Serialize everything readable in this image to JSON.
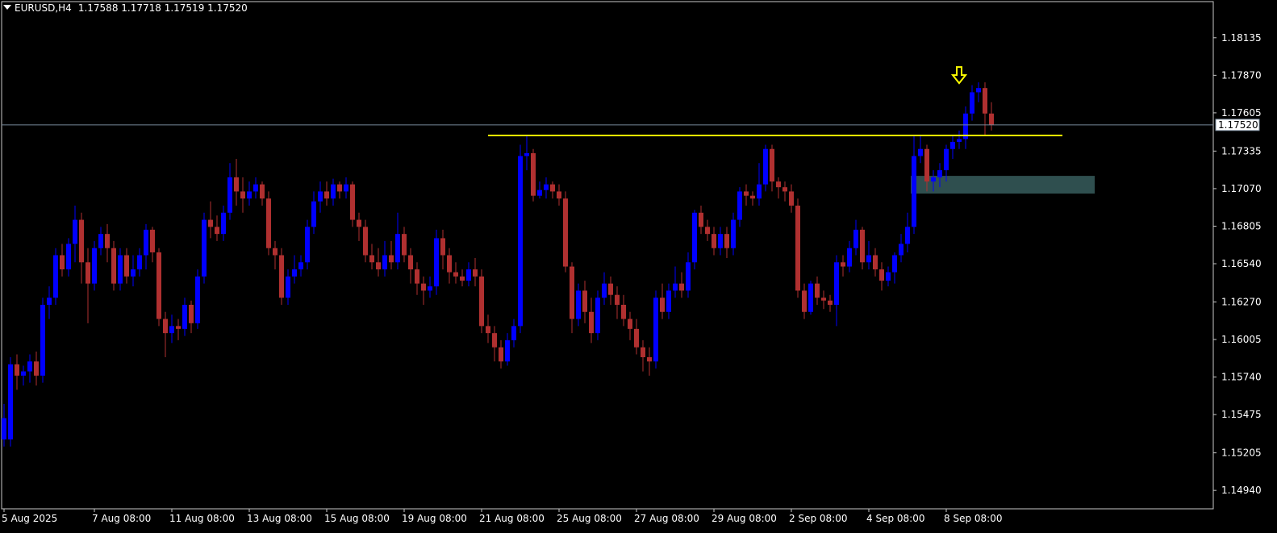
{
  "header": {
    "symbol_timeframe": "EURUSD,H4",
    "ohlc": "1.17588 1.17718 1.17519 1.17520"
  },
  "colors": {
    "background": "#000000",
    "frame": "#c8c8c8",
    "bull": "#0000ff",
    "bear": "#b03030",
    "resistance_line": "#ffff00",
    "zone_fill": "#2f4f4f",
    "bid_line": "#778899",
    "arrow": "#ffff00",
    "text": "#ffffff"
  },
  "chart_data": {
    "type": "candlestick",
    "symbol": "EURUSD",
    "timeframe": "H4",
    "ylim": [
      1.1481,
      1.1839
    ],
    "y_ticks": [
      "1.18135",
      "1.17870",
      "1.17605",
      "1.17335",
      "1.17070",
      "1.16805",
      "1.16540",
      "1.16270",
      "1.16005",
      "1.15740",
      "1.15475",
      "1.15205",
      "1.14940"
    ],
    "x_ticks": [
      "5 Aug 2025",
      "7 Aug 08:00",
      "11 Aug 08:00",
      "13 Aug 08:00",
      "15 Aug 08:00",
      "19 Aug 08:00",
      "21 Aug 08:00",
      "25 Aug 08:00",
      "27 Aug 08:00",
      "29 Aug 08:00",
      "2 Sep 08:00",
      "4 Sep 08:00",
      "8 Sep 08:00"
    ],
    "x_tick_candle_index": [
      0,
      14,
      26,
      38,
      50,
      62,
      74,
      86,
      98,
      110,
      122,
      134,
      146
    ],
    "current_price": "1.17520",
    "resistance_level": 1.17445,
    "resistance_from_index": 75,
    "resistance_to_index": 164,
    "demand_zone": {
      "low": 1.17035,
      "high": 1.1716,
      "from_index": 141,
      "to_index": 169
    },
    "signal_arrow": {
      "index": 148,
      "direction": "down",
      "price": 1.1786
    },
    "candles": [
      [
        1.153,
        1.1545,
        1.1525,
        1.1555
      ],
      [
        1.153,
        1.1583,
        1.1525,
        1.1588
      ],
      [
        1.1583,
        1.1575,
        1.1565,
        1.159
      ],
      [
        1.1575,
        1.1578,
        1.1568,
        1.1582
      ],
      [
        1.1578,
        1.1585,
        1.157,
        1.159
      ],
      [
        1.1585,
        1.1575,
        1.1568,
        1.1592
      ],
      [
        1.1575,
        1.1625,
        1.157,
        1.163
      ],
      [
        1.1625,
        1.163,
        1.1615,
        1.1638
      ],
      [
        1.163,
        1.166,
        1.1625,
        1.1665
      ],
      [
        1.166,
        1.165,
        1.1645,
        1.1668
      ],
      [
        1.165,
        1.1668,
        1.1645,
        1.1672
      ],
      [
        1.1668,
        1.1685,
        1.1655,
        1.1695
      ],
      [
        1.1685,
        1.1655,
        1.164,
        1.169
      ],
      [
        1.1655,
        1.164,
        1.1612,
        1.1665
      ],
      [
        1.164,
        1.1665,
        1.1635,
        1.167
      ],
      [
        1.1665,
        1.1675,
        1.166,
        1.168
      ],
      [
        1.1675,
        1.1665,
        1.1655,
        1.1682
      ],
      [
        1.1665,
        1.164,
        1.1635,
        1.167
      ],
      [
        1.164,
        1.166,
        1.1635,
        1.1665
      ],
      [
        1.166,
        1.1645,
        1.164,
        1.1665
      ],
      [
        1.1645,
        1.165,
        1.1638,
        1.166
      ],
      [
        1.165,
        1.166,
        1.1645,
        1.1665
      ],
      [
        1.166,
        1.1678,
        1.165,
        1.1682
      ],
      [
        1.1678,
        1.1662,
        1.1655,
        1.168
      ],
      [
        1.1662,
        1.1615,
        1.161,
        1.1665
      ],
      [
        1.1615,
        1.1605,
        1.1588,
        1.162
      ],
      [
        1.1605,
        1.161,
        1.1598,
        1.1618
      ],
      [
        1.161,
        1.1608,
        1.16,
        1.1615
      ],
      [
        1.1608,
        1.1625,
        1.1603,
        1.163
      ],
      [
        1.1625,
        1.1612,
        1.1605,
        1.1628
      ],
      [
        1.1612,
        1.1645,
        1.1608,
        1.165
      ],
      [
        1.1645,
        1.1685,
        1.164,
        1.169
      ],
      [
        1.1685,
        1.168,
        1.1672,
        1.1698
      ],
      [
        1.168,
        1.1675,
        1.167,
        1.1688
      ],
      [
        1.1675,
        1.169,
        1.167,
        1.1695
      ],
      [
        1.169,
        1.1715,
        1.1685,
        1.1725
      ],
      [
        1.1715,
        1.1705,
        1.1695,
        1.1728
      ],
      [
        1.1705,
        1.17,
        1.169,
        1.1715
      ],
      [
        1.17,
        1.1705,
        1.1695,
        1.1712
      ],
      [
        1.1705,
        1.171,
        1.17,
        1.1715
      ],
      [
        1.171,
        1.17,
        1.1695,
        1.1712
      ],
      [
        1.17,
        1.1665,
        1.166,
        1.1705
      ],
      [
        1.1665,
        1.166,
        1.165,
        1.167
      ],
      [
        1.166,
        1.163,
        1.1625,
        1.1665
      ],
      [
        1.163,
        1.1645,
        1.1625,
        1.165
      ],
      [
        1.1645,
        1.165,
        1.164,
        1.166
      ],
      [
        1.165,
        1.1655,
        1.1645,
        1.166
      ],
      [
        1.1655,
        1.168,
        1.165,
        1.1685
      ],
      [
        1.168,
        1.1698,
        1.1675,
        1.1705
      ],
      [
        1.1698,
        1.1705,
        1.169,
        1.1712
      ],
      [
        1.1705,
        1.17,
        1.1695,
        1.1712
      ],
      [
        1.17,
        1.171,
        1.1695,
        1.1714
      ],
      [
        1.171,
        1.1705,
        1.17,
        1.1712
      ],
      [
        1.1705,
        1.171,
        1.17,
        1.1715
      ],
      [
        1.171,
        1.1685,
        1.168,
        1.1712
      ],
      [
        1.1685,
        1.168,
        1.167,
        1.169
      ],
      [
        1.168,
        1.166,
        1.1655,
        1.1685
      ],
      [
        1.166,
        1.1655,
        1.165,
        1.1668
      ],
      [
        1.1655,
        1.165,
        1.1645,
        1.1665
      ],
      [
        1.165,
        1.166,
        1.1645,
        1.167
      ],
      [
        1.166,
        1.1655,
        1.165,
        1.167
      ],
      [
        1.1655,
        1.1675,
        1.165,
        1.169
      ],
      [
        1.1675,
        1.166,
        1.1655,
        1.168
      ],
      [
        1.166,
        1.165,
        1.164,
        1.1665
      ],
      [
        1.165,
        1.164,
        1.1632,
        1.1655
      ],
      [
        1.164,
        1.1635,
        1.1625,
        1.1645
      ],
      [
        1.1635,
        1.1638,
        1.163,
        1.1645
      ],
      [
        1.1638,
        1.1672,
        1.1632,
        1.1678
      ],
      [
        1.1672,
        1.166,
        1.165,
        1.1678
      ],
      [
        1.166,
        1.1648,
        1.164,
        1.1665
      ],
      [
        1.1648,
        1.1645,
        1.164,
        1.1655
      ],
      [
        1.1645,
        1.1642,
        1.1638,
        1.165
      ],
      [
        1.1642,
        1.165,
        1.1638,
        1.1655
      ],
      [
        1.165,
        1.1645,
        1.1638,
        1.1658
      ],
      [
        1.1645,
        1.161,
        1.1605,
        1.165
      ],
      [
        1.161,
        1.1605,
        1.1598,
        1.1618
      ],
      [
        1.1605,
        1.1595,
        1.1585,
        1.161
      ],
      [
        1.1595,
        1.1585,
        1.158,
        1.16
      ],
      [
        1.1585,
        1.16,
        1.1582,
        1.1605
      ],
      [
        1.16,
        1.161,
        1.1595,
        1.1615
      ],
      [
        1.161,
        1.173,
        1.1605,
        1.1738
      ],
      [
        1.173,
        1.1732,
        1.172,
        1.1745
      ],
      [
        1.1732,
        1.1702,
        1.1698,
        1.1735
      ],
      [
        1.1702,
        1.1706,
        1.17,
        1.1712
      ],
      [
        1.1706,
        1.171,
        1.17,
        1.1715
      ],
      [
        1.171,
        1.1705,
        1.17,
        1.1712
      ],
      [
        1.1705,
        1.17,
        1.1695,
        1.171
      ],
      [
        1.17,
        1.1652,
        1.1648,
        1.1705
      ],
      [
        1.1652,
        1.1615,
        1.1605,
        1.1655
      ],
      [
        1.1615,
        1.1635,
        1.161,
        1.164
      ],
      [
        1.1635,
        1.162,
        1.1612,
        1.1642
      ],
      [
        1.162,
        1.1605,
        1.1598,
        1.163
      ],
      [
        1.1605,
        1.163,
        1.16,
        1.1635
      ],
      [
        1.163,
        1.164,
        1.1625,
        1.1648
      ],
      [
        1.164,
        1.1632,
        1.1625,
        1.1645
      ],
      [
        1.1632,
        1.1625,
        1.1615,
        1.1638
      ],
      [
        1.1625,
        1.1615,
        1.161,
        1.1632
      ],
      [
        1.1615,
        1.1608,
        1.16,
        1.162
      ],
      [
        1.1608,
        1.1595,
        1.159,
        1.1615
      ],
      [
        1.1595,
        1.1588,
        1.1578,
        1.16
      ],
      [
        1.1588,
        1.1585,
        1.1575,
        1.1595
      ],
      [
        1.1585,
        1.163,
        1.158,
        1.1635
      ],
      [
        1.163,
        1.162,
        1.1615,
        1.164
      ],
      [
        1.162,
        1.1635,
        1.1615,
        1.164
      ],
      [
        1.1635,
        1.164,
        1.163,
        1.1652
      ],
      [
        1.164,
        1.1635,
        1.163,
        1.1648
      ],
      [
        1.1635,
        1.1655,
        1.163,
        1.1662
      ],
      [
        1.1655,
        1.169,
        1.165,
        1.1692
      ],
      [
        1.169,
        1.168,
        1.1675,
        1.1695
      ],
      [
        1.168,
        1.1675,
        1.167,
        1.1685
      ],
      [
        1.1675,
        1.1665,
        1.166,
        1.168
      ],
      [
        1.1665,
        1.1675,
        1.166,
        1.168
      ],
      [
        1.1675,
        1.1665,
        1.1658,
        1.168
      ],
      [
        1.1665,
        1.1685,
        1.166,
        1.169
      ],
      [
        1.1685,
        1.1705,
        1.168,
        1.1708
      ],
      [
        1.1705,
        1.1702,
        1.1695,
        1.171
      ],
      [
        1.1702,
        1.17,
        1.1695,
        1.1705
      ],
      [
        1.17,
        1.171,
        1.1695,
        1.1725
      ],
      [
        1.171,
        1.1735,
        1.1705,
        1.1738
      ],
      [
        1.1735,
        1.1712,
        1.1705,
        1.1738
      ],
      [
        1.1712,
        1.1708,
        1.17,
        1.1715
      ],
      [
        1.1708,
        1.1705,
        1.1698,
        1.1712
      ],
      [
        1.1705,
        1.1695,
        1.169,
        1.171
      ],
      [
        1.1695,
        1.1635,
        1.163,
        1.17
      ],
      [
        1.1635,
        1.162,
        1.1615,
        1.164
      ],
      [
        1.162,
        1.164,
        1.1618,
        1.1642
      ],
      [
        1.164,
        1.163,
        1.1625,
        1.1645
      ],
      [
        1.163,
        1.1628,
        1.1622,
        1.1635
      ],
      [
        1.1628,
        1.1625,
        1.162,
        1.1632
      ],
      [
        1.1625,
        1.1655,
        1.161,
        1.166
      ],
      [
        1.1655,
        1.1652,
        1.1645,
        1.166
      ],
      [
        1.1652,
        1.1665,
        1.1648,
        1.167
      ],
      [
        1.1665,
        1.1678,
        1.166,
        1.1685
      ],
      [
        1.1678,
        1.1655,
        1.165,
        1.168
      ],
      [
        1.1655,
        1.166,
        1.165,
        1.167
      ],
      [
        1.166,
        1.165,
        1.1645,
        1.1665
      ],
      [
        1.165,
        1.1642,
        1.1635,
        1.1655
      ],
      [
        1.1642,
        1.1648,
        1.1638,
        1.1652
      ],
      [
        1.1648,
        1.166,
        1.164,
        1.1662
      ],
      [
        1.166,
        1.1668,
        1.1655,
        1.1675
      ],
      [
        1.1668,
        1.168,
        1.1662,
        1.169
      ],
      [
        1.168,
        1.173,
        1.1675,
        1.1745
      ],
      [
        1.173,
        1.1735,
        1.1725,
        1.1745
      ],
      [
        1.1735,
        1.1712,
        1.1705,
        1.1738
      ],
      [
        1.1712,
        1.1715,
        1.1705,
        1.172
      ],
      [
        1.1715,
        1.172,
        1.1708,
        1.1725
      ],
      [
        1.172,
        1.1735,
        1.1712,
        1.1738
      ],
      [
        1.1735,
        1.174,
        1.1728,
        1.1745
      ],
      [
        1.174,
        1.1742,
        1.1735,
        1.1748
      ],
      [
        1.1742,
        1.176,
        1.1735,
        1.1765
      ],
      [
        1.176,
        1.1775,
        1.1755,
        1.178
      ],
      [
        1.1775,
        1.1778,
        1.1768,
        1.1782
      ],
      [
        1.1778,
        1.176,
        1.1745,
        1.1782
      ],
      [
        1.176,
        1.1752,
        1.1748,
        1.1768
      ]
    ]
  }
}
